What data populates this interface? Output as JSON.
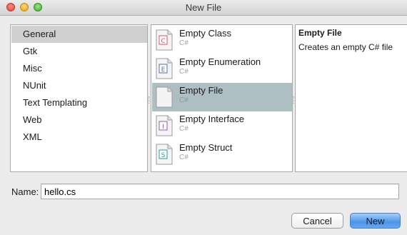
{
  "window": {
    "title": "New File"
  },
  "categories": [
    {
      "label": "General",
      "selected": true
    },
    {
      "label": "Gtk",
      "selected": false
    },
    {
      "label": "Misc",
      "selected": false
    },
    {
      "label": "NUnit",
      "selected": false
    },
    {
      "label": "Text Templating",
      "selected": false
    },
    {
      "label": "Web",
      "selected": false
    },
    {
      "label": "XML",
      "selected": false
    }
  ],
  "templates": [
    {
      "name": "Empty Class",
      "lang": "C#",
      "icon": "class-file-icon",
      "badge": "C",
      "badge_color": "#d9556a",
      "selected": false
    },
    {
      "name": "Empty Enumeration",
      "lang": "C#",
      "icon": "enum-file-icon",
      "badge": "E",
      "badge_color": "#4a6fb5",
      "selected": false
    },
    {
      "name": "Empty File",
      "lang": "C#",
      "icon": "blank-file-icon",
      "badge": "",
      "badge_color": "",
      "selected": true
    },
    {
      "name": "Empty Interface",
      "lang": "C#",
      "icon": "interface-file-icon",
      "badge": "I",
      "badge_color": "#9b59b6",
      "selected": false
    },
    {
      "name": "Empty Struct",
      "lang": "C#",
      "icon": "struct-file-icon",
      "badge": "S",
      "badge_color": "#2a9d9d",
      "selected": false
    }
  ],
  "description": {
    "title": "Empty File",
    "text": "Creates an empty C# file"
  },
  "name_field": {
    "label": "Name:",
    "value": "hello.cs"
  },
  "buttons": {
    "cancel": "Cancel",
    "new": "New"
  },
  "colors": {
    "selected_category": "#d0d0d0",
    "selected_template": "#aebfc4",
    "default_button": "#4b95ea"
  }
}
